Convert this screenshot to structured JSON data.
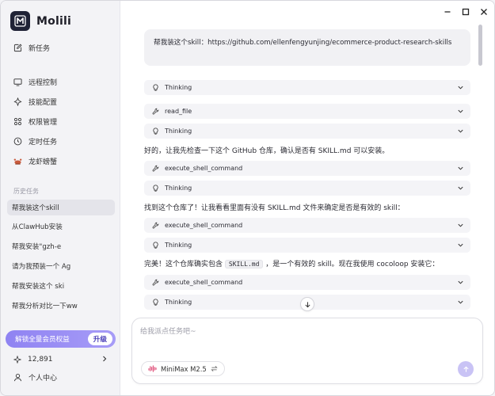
{
  "app": {
    "title": "Molili"
  },
  "sidebar": {
    "new_task": "新任务",
    "nav": [
      {
        "label": "远程控制",
        "icon": "remote-control-icon"
      },
      {
        "label": "技能配置",
        "icon": "skill-config-icon"
      },
      {
        "label": "权限管理",
        "icon": "permission-icon"
      },
      {
        "label": "定时任务",
        "icon": "clock-icon"
      },
      {
        "label": "龙虾螃蟹",
        "icon": "crab-icon"
      }
    ],
    "history_label": "历史任务",
    "history": [
      {
        "label": "帮我装这个skill",
        "active": true
      },
      {
        "label": "从ClawHub安装",
        "active": false
      },
      {
        "label": "帮我安装\"gzh-e",
        "active": false
      },
      {
        "label": "请为我预装一个 Ag",
        "active": false
      },
      {
        "label": "帮我安装这个 ski",
        "active": false
      },
      {
        "label": "帮我分析对比一下ww",
        "active": false
      }
    ],
    "upgrade_text": "解锁全量会员权益",
    "upgrade_button": "升级",
    "credits": "12,891",
    "profile": "个人中心"
  },
  "chat": {
    "user_message": "帮我装这个skill：https://github.com/ellenfengyunjing/ecommerce-product-research-skills",
    "steps": [
      {
        "kind": "tool",
        "label": "Thinking",
        "icon": "lightbulb-icon"
      },
      {
        "kind": "tool",
        "label": "read_file",
        "icon": "tool-icon"
      },
      {
        "kind": "tool",
        "label": "Thinking",
        "icon": "lightbulb-icon"
      },
      {
        "kind": "text",
        "label": "好的，让我先检查一下这个 GitHub 仓库，确认是否有 SKILL.md 可以安装。"
      },
      {
        "kind": "tool",
        "label": "execute_shell_command",
        "icon": "tool-icon"
      },
      {
        "kind": "tool",
        "label": "Thinking",
        "icon": "lightbulb-icon"
      },
      {
        "kind": "text",
        "label": "找到这个仓库了！让我看看里面有没有 SKILL.md 文件来确定是否是有效的 skill："
      },
      {
        "kind": "tool",
        "label": "execute_shell_command",
        "icon": "tool-icon"
      },
      {
        "kind": "tool",
        "label": "Thinking",
        "icon": "lightbulb-icon"
      },
      {
        "kind": "text_code",
        "before": "完美！这个仓库确实包含",
        "code": "SKILL.md",
        "after": "，是一个有效的 skill。现在我使用 cocoloop 安装它："
      },
      {
        "kind": "tool",
        "label": "execute_shell_command",
        "icon": "tool-icon"
      },
      {
        "kind": "tool",
        "label": "Thinking",
        "icon": "lightbulb-icon"
      }
    ]
  },
  "composer": {
    "placeholder": "给我派点任务吧~",
    "model": "MiniMax M2.5"
  },
  "colors": {
    "accent": "#8f83f2",
    "send_disabled": "#c9c3f5"
  }
}
